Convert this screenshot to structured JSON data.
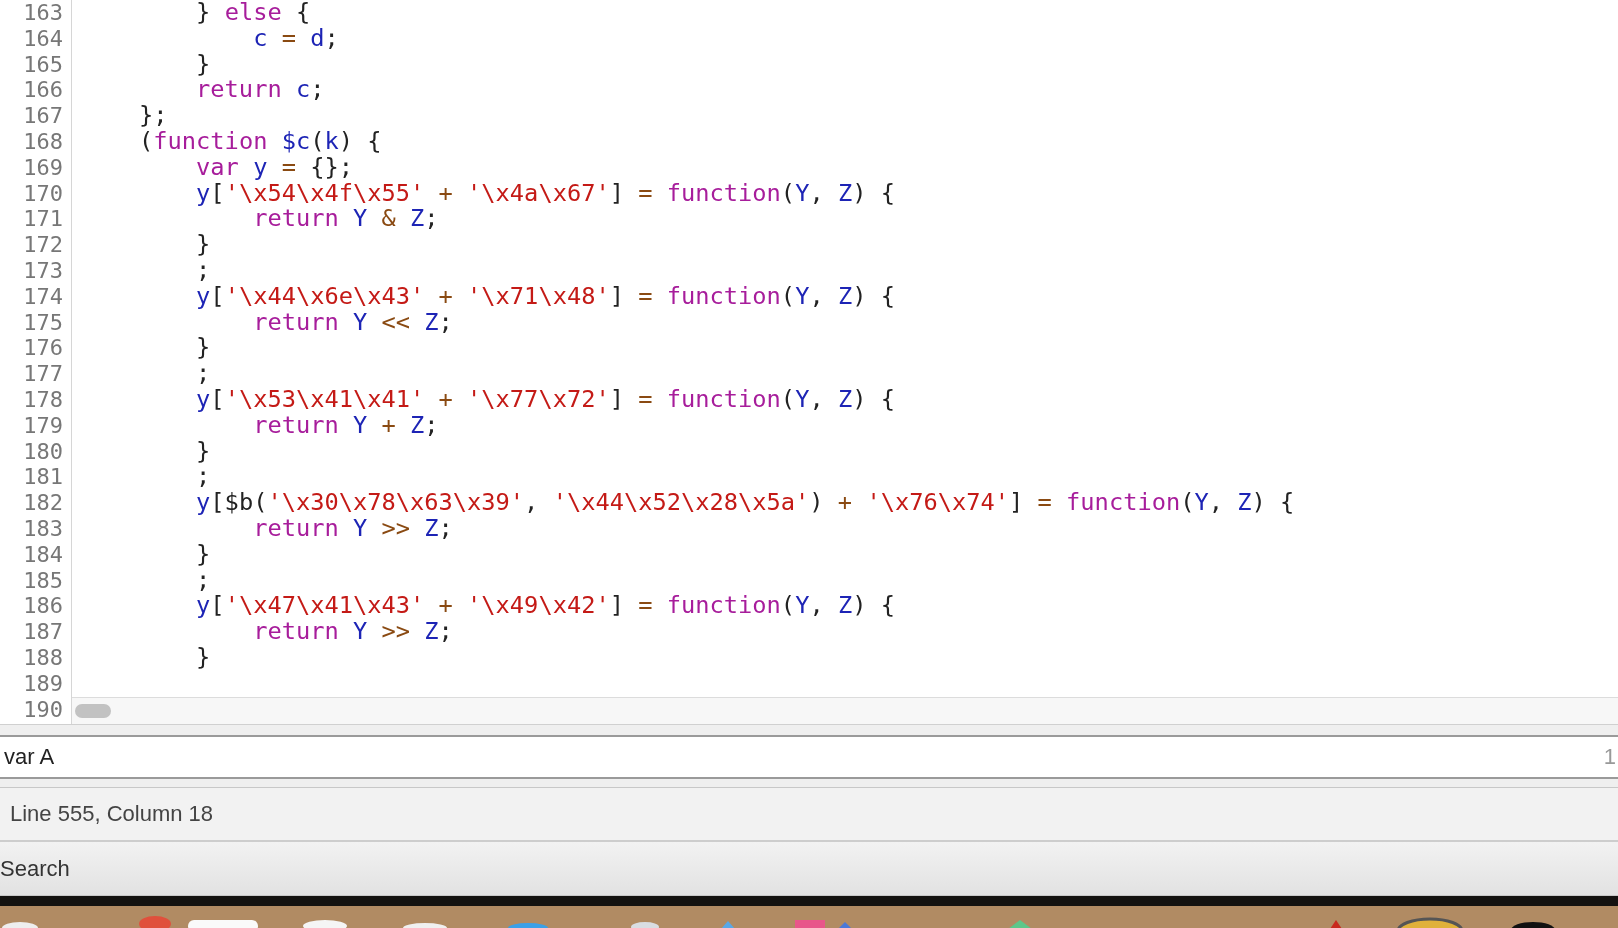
{
  "editor": {
    "lines": [
      {
        "number": "163",
        "tokens": [
          {
            "kind": "plain",
            "text": "        } "
          },
          {
            "kind": "keyword",
            "text": "else"
          },
          {
            "kind": "plain",
            "text": " {"
          }
        ]
      },
      {
        "number": "164",
        "tokens": [
          {
            "kind": "variable",
            "text": "            c"
          },
          {
            "kind": "operator",
            "text": " = "
          },
          {
            "kind": "variable",
            "text": "d"
          },
          {
            "kind": "plain",
            "text": ";"
          }
        ]
      },
      {
        "number": "165",
        "tokens": [
          {
            "kind": "plain",
            "text": "        }"
          }
        ]
      },
      {
        "number": "166",
        "tokens": [
          {
            "kind": "keyword",
            "text": "        return "
          },
          {
            "kind": "variable",
            "text": "c"
          },
          {
            "kind": "plain",
            "text": ";"
          }
        ]
      },
      {
        "number": "167",
        "tokens": [
          {
            "kind": "plain",
            "text": "    };"
          }
        ]
      },
      {
        "number": "168",
        "tokens": [
          {
            "kind": "plain",
            "text": "    ("
          },
          {
            "kind": "keyword",
            "text": "function "
          },
          {
            "kind": "variable",
            "text": "$c"
          },
          {
            "kind": "plain",
            "text": "("
          },
          {
            "kind": "variable",
            "text": "k"
          },
          {
            "kind": "plain",
            "text": ") {"
          }
        ]
      },
      {
        "number": "169",
        "tokens": [
          {
            "kind": "keyword",
            "text": "        var "
          },
          {
            "kind": "variable",
            "text": "y"
          },
          {
            "kind": "operator",
            "text": " = "
          },
          {
            "kind": "plain",
            "text": "{};"
          }
        ]
      },
      {
        "number": "170",
        "tokens": [
          {
            "kind": "variable",
            "text": "        y"
          },
          {
            "kind": "plain",
            "text": "["
          },
          {
            "kind": "string",
            "text": "'\\x54\\x4f\\x55'"
          },
          {
            "kind": "operator",
            "text": " + "
          },
          {
            "kind": "string",
            "text": "'\\x4a\\x67'"
          },
          {
            "kind": "plain",
            "text": "] "
          },
          {
            "kind": "operator",
            "text": "= "
          },
          {
            "kind": "keyword",
            "text": "function"
          },
          {
            "kind": "plain",
            "text": "("
          },
          {
            "kind": "variable",
            "text": "Y"
          },
          {
            "kind": "plain",
            "text": ", "
          },
          {
            "kind": "variable",
            "text": "Z"
          },
          {
            "kind": "plain",
            "text": ") {"
          }
        ]
      },
      {
        "number": "171",
        "tokens": [
          {
            "kind": "keyword",
            "text": "            return "
          },
          {
            "kind": "variable",
            "text": "Y"
          },
          {
            "kind": "operator",
            "text": " & "
          },
          {
            "kind": "variable",
            "text": "Z"
          },
          {
            "kind": "plain",
            "text": ";"
          }
        ]
      },
      {
        "number": "172",
        "tokens": [
          {
            "kind": "plain",
            "text": "        }"
          }
        ]
      },
      {
        "number": "173",
        "tokens": [
          {
            "kind": "plain",
            "text": "        ;"
          }
        ]
      },
      {
        "number": "174",
        "tokens": [
          {
            "kind": "variable",
            "text": "        y"
          },
          {
            "kind": "plain",
            "text": "["
          },
          {
            "kind": "string",
            "text": "'\\x44\\x6e\\x43'"
          },
          {
            "kind": "operator",
            "text": " + "
          },
          {
            "kind": "string",
            "text": "'\\x71\\x48'"
          },
          {
            "kind": "plain",
            "text": "] "
          },
          {
            "kind": "operator",
            "text": "= "
          },
          {
            "kind": "keyword",
            "text": "function"
          },
          {
            "kind": "plain",
            "text": "("
          },
          {
            "kind": "variable",
            "text": "Y"
          },
          {
            "kind": "plain",
            "text": ", "
          },
          {
            "kind": "variable",
            "text": "Z"
          },
          {
            "kind": "plain",
            "text": ") {"
          }
        ]
      },
      {
        "number": "175",
        "tokens": [
          {
            "kind": "keyword",
            "text": "            return "
          },
          {
            "kind": "variable",
            "text": "Y"
          },
          {
            "kind": "operator",
            "text": " << "
          },
          {
            "kind": "variable",
            "text": "Z"
          },
          {
            "kind": "plain",
            "text": ";"
          }
        ]
      },
      {
        "number": "176",
        "tokens": [
          {
            "kind": "plain",
            "text": "        }"
          }
        ]
      },
      {
        "number": "177",
        "tokens": [
          {
            "kind": "plain",
            "text": "        ;"
          }
        ]
      },
      {
        "number": "178",
        "tokens": [
          {
            "kind": "variable",
            "text": "        y"
          },
          {
            "kind": "plain",
            "text": "["
          },
          {
            "kind": "string",
            "text": "'\\x53\\x41\\x41'"
          },
          {
            "kind": "operator",
            "text": " + "
          },
          {
            "kind": "string",
            "text": "'\\x77\\x72'"
          },
          {
            "kind": "plain",
            "text": "] "
          },
          {
            "kind": "operator",
            "text": "= "
          },
          {
            "kind": "keyword",
            "text": "function"
          },
          {
            "kind": "plain",
            "text": "("
          },
          {
            "kind": "variable",
            "text": "Y"
          },
          {
            "kind": "plain",
            "text": ", "
          },
          {
            "kind": "variable",
            "text": "Z"
          },
          {
            "kind": "plain",
            "text": ") {"
          }
        ]
      },
      {
        "number": "179",
        "tokens": [
          {
            "kind": "keyword",
            "text": "            return "
          },
          {
            "kind": "variable",
            "text": "Y"
          },
          {
            "kind": "operator",
            "text": " + "
          },
          {
            "kind": "variable",
            "text": "Z"
          },
          {
            "kind": "plain",
            "text": ";"
          }
        ]
      },
      {
        "number": "180",
        "tokens": [
          {
            "kind": "plain",
            "text": "        }"
          }
        ]
      },
      {
        "number": "181",
        "tokens": [
          {
            "kind": "plain",
            "text": "        ;"
          }
        ]
      },
      {
        "number": "182",
        "tokens": [
          {
            "kind": "variable",
            "text": "        y"
          },
          {
            "kind": "plain",
            "text": "[$b("
          },
          {
            "kind": "string",
            "text": "'\\x30\\x78\\x63\\x39'"
          },
          {
            "kind": "plain",
            "text": ", "
          },
          {
            "kind": "string",
            "text": "'\\x44\\x52\\x28\\x5a'"
          },
          {
            "kind": "plain",
            "text": ")"
          },
          {
            "kind": "operator",
            "text": " + "
          },
          {
            "kind": "string",
            "text": "'\\x76\\x74'"
          },
          {
            "kind": "plain",
            "text": "] "
          },
          {
            "kind": "operator",
            "text": "= "
          },
          {
            "kind": "keyword",
            "text": "function"
          },
          {
            "kind": "plain",
            "text": "("
          },
          {
            "kind": "variable",
            "text": "Y"
          },
          {
            "kind": "plain",
            "text": ", "
          },
          {
            "kind": "variable",
            "text": "Z"
          },
          {
            "kind": "plain",
            "text": ") {"
          }
        ]
      },
      {
        "number": "183",
        "tokens": [
          {
            "kind": "keyword",
            "text": "            return "
          },
          {
            "kind": "variable",
            "text": "Y"
          },
          {
            "kind": "operator",
            "text": " >> "
          },
          {
            "kind": "variable",
            "text": "Z"
          },
          {
            "kind": "plain",
            "text": ";"
          }
        ]
      },
      {
        "number": "184",
        "tokens": [
          {
            "kind": "plain",
            "text": "        }"
          }
        ]
      },
      {
        "number": "185",
        "tokens": [
          {
            "kind": "plain",
            "text": "        ;"
          }
        ]
      },
      {
        "number": "186",
        "tokens": [
          {
            "kind": "variable",
            "text": "        y"
          },
          {
            "kind": "plain",
            "text": "["
          },
          {
            "kind": "string",
            "text": "'\\x47\\x41\\x43'"
          },
          {
            "kind": "operator",
            "text": " + "
          },
          {
            "kind": "string",
            "text": "'\\x49\\x42'"
          },
          {
            "kind": "plain",
            "text": "] "
          },
          {
            "kind": "operator",
            "text": "= "
          },
          {
            "kind": "keyword",
            "text": "function"
          },
          {
            "kind": "plain",
            "text": "("
          },
          {
            "kind": "variable",
            "text": "Y"
          },
          {
            "kind": "plain",
            "text": ", "
          },
          {
            "kind": "variable",
            "text": "Z"
          },
          {
            "kind": "plain",
            "text": ") {"
          }
        ]
      },
      {
        "number": "187",
        "tokens": [
          {
            "kind": "keyword",
            "text": "            return "
          },
          {
            "kind": "variable",
            "text": "Y"
          },
          {
            "kind": "operator",
            "text": " >> "
          },
          {
            "kind": "variable",
            "text": "Z"
          },
          {
            "kind": "plain",
            "text": ";"
          }
        ]
      },
      {
        "number": "188",
        "tokens": [
          {
            "kind": "plain",
            "text": "        }"
          }
        ]
      },
      {
        "number": "189"
      },
      {
        "number": "190"
      }
    ]
  },
  "search": {
    "value": "var A",
    "match_count": "1"
  },
  "status_bar": {
    "text": "Line 555, Column 18"
  },
  "drawer_tab": {
    "label": "Search"
  }
}
